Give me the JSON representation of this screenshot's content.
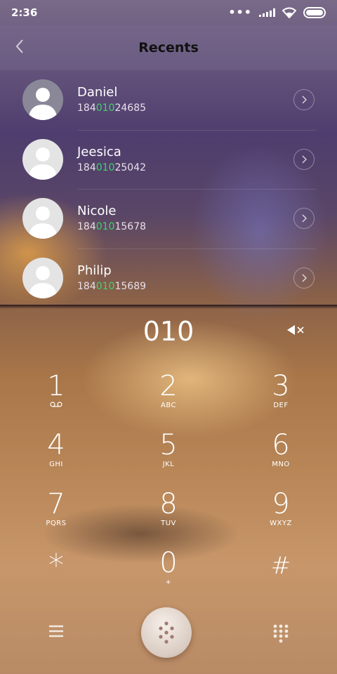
{
  "status_bar": {
    "time": "2:36",
    "icons": [
      "dots-icon",
      "signal-icon",
      "wifi-icon",
      "battery-icon"
    ]
  },
  "header": {
    "title": "Recents",
    "back_icon": "chevron-left-icon"
  },
  "recents": [
    {
      "name": "Daniel",
      "number_prefix": "184",
      "number_match": "010",
      "number_suffix": "24685"
    },
    {
      "name": "Jeesica",
      "number_prefix": "184",
      "number_match": "010",
      "number_suffix": "25042"
    },
    {
      "name": "Nicole",
      "number_prefix": "184",
      "number_match": "010",
      "number_suffix": "15678"
    },
    {
      "name": "Philip",
      "number_prefix": "184",
      "number_match": "010",
      "number_suffix": "15689"
    }
  ],
  "dialed_number": "010",
  "keypad": [
    {
      "digit": "1",
      "letters": ""
    },
    {
      "digit": "2",
      "letters": "ABC"
    },
    {
      "digit": "3",
      "letters": "DEF"
    },
    {
      "digit": "4",
      "letters": "GHI"
    },
    {
      "digit": "5",
      "letters": "JKL"
    },
    {
      "digit": "6",
      "letters": "MNO"
    },
    {
      "digit": "7",
      "letters": "PQRS"
    },
    {
      "digit": "8",
      "letters": "TUV"
    },
    {
      "digit": "9",
      "letters": "WXYZ"
    },
    {
      "digit": "*",
      "letters": ""
    },
    {
      "digit": "0",
      "letters": "+"
    },
    {
      "digit": "#",
      "letters": ""
    }
  ],
  "colors": {
    "match_highlight": "#3dd66b",
    "title": "#111111"
  },
  "bottom_bar": {
    "icons": [
      "menu-icon",
      "dialpad-icon",
      "t9-keypad-icon"
    ]
  }
}
